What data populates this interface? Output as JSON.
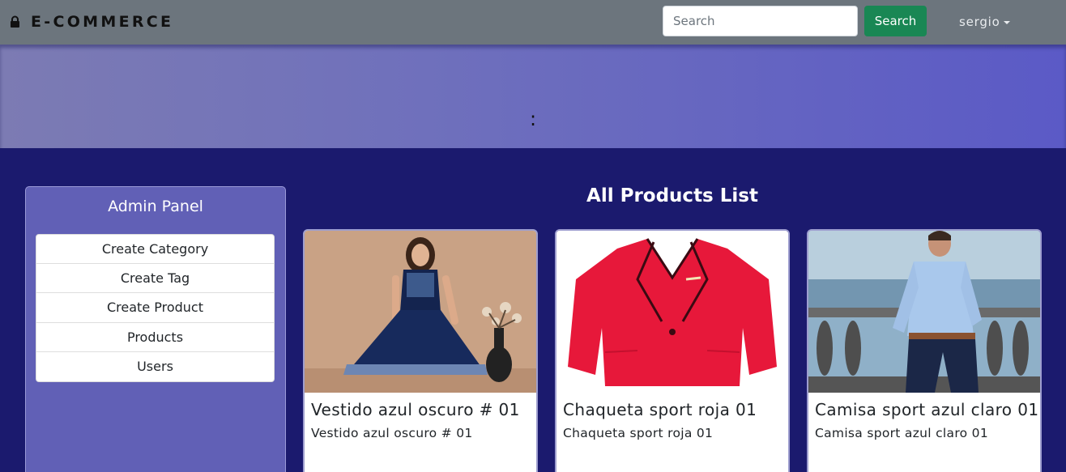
{
  "navbar": {
    "brand": "E-COMMERCE",
    "brand_icon": "lock-icon",
    "search_placeholder": "Search",
    "search_value": "",
    "search_button": "Search",
    "user": "sergio",
    "background": "#6c757d",
    "search_button_color": "#198754"
  },
  "hero": {
    "text": ":"
  },
  "admin_panel": {
    "title": "Admin Panel",
    "items": [
      {
        "label": "Create Category"
      },
      {
        "label": "Create Tag"
      },
      {
        "label": "Create Product"
      },
      {
        "label": "Products"
      },
      {
        "label": "Users"
      }
    ]
  },
  "products": {
    "title": "All Products List",
    "items": [
      {
        "title": "Vestido azul oscuro # 01",
        "description": "Vestido azul oscuro # 01",
        "image": "navy-blue-dress-photo"
      },
      {
        "title": "Chaqueta sport roja 01",
        "description": "Chaqueta sport roja 01",
        "image": "red-sport-jacket-photo"
      },
      {
        "title": "Camisa sport azul claro 01",
        "description": "Camisa sport azul claro 01",
        "image": "light-blue-shirt-photo"
      }
    ]
  },
  "colors": {
    "page_background": "#1b1a6e",
    "panel_background": "#6160b6",
    "hero_gradient_start": "#7c7bb3",
    "hero_gradient_end": "#5b5ac6"
  }
}
